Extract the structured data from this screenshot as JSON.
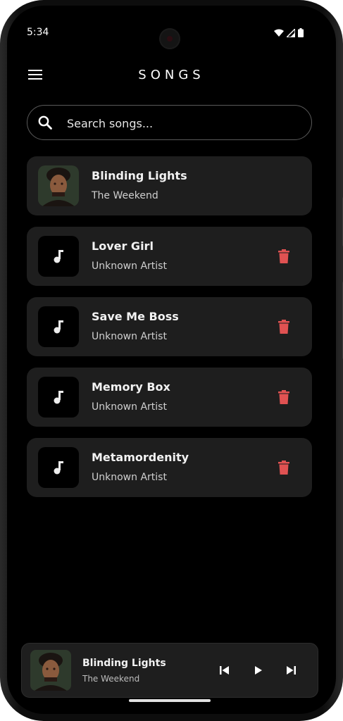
{
  "status_bar": {
    "time": "5:34",
    "icons": [
      "wifi-icon",
      "signal-icon",
      "battery-icon"
    ]
  },
  "header": {
    "title": "SONGS",
    "menu_icon": "menu-icon"
  },
  "search": {
    "placeholder": "Search songs...",
    "value": "",
    "icon": "search-icon"
  },
  "songs": [
    {
      "title": "Blinding Lights",
      "artist": "The Weekend",
      "art": "album-art",
      "deletable": false
    },
    {
      "title": "Lover Girl",
      "artist": "Unknown Artist",
      "art": "music-note-icon",
      "deletable": true
    },
    {
      "title": "Save Me Boss",
      "artist": "Unknown Artist",
      "art": "music-note-icon",
      "deletable": true
    },
    {
      "title": "Memory Box",
      "artist": "Unknown Artist",
      "art": "music-note-icon",
      "deletable": true
    },
    {
      "title": "Metamordenity",
      "artist": "Unknown Artist",
      "art": "music-note-icon",
      "deletable": true
    }
  ],
  "now_playing": {
    "title": "Blinding Lights",
    "artist": "The Weekend",
    "controls": [
      "skip-previous-icon",
      "play-icon",
      "skip-next-icon"
    ]
  },
  "colors": {
    "background": "#000000",
    "card": "#1e1e1e",
    "delete": "#e05252",
    "text": "#f2f2f2",
    "subtext": "#cfcfcf"
  }
}
